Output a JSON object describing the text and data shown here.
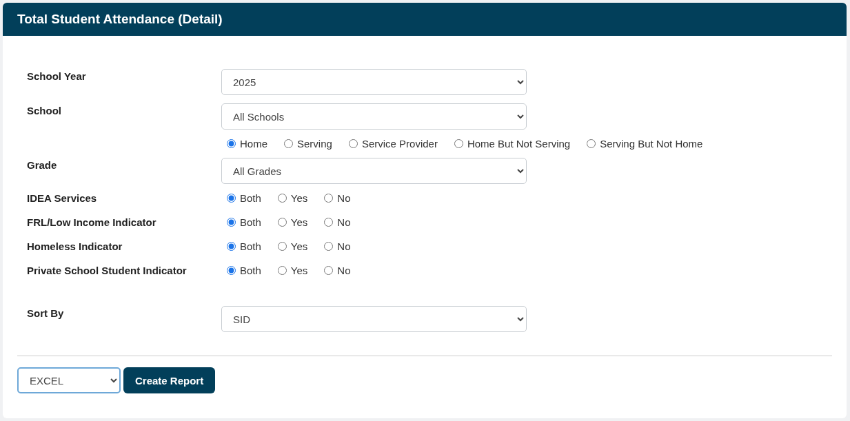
{
  "title": "Total Student Attendance (Detail)",
  "filters": [
    {
      "label": "School Year",
      "kind": "select",
      "value": "2025"
    },
    {
      "label": "School",
      "kind": "select",
      "value": "All Schools",
      "options": [
        {
          "label": "Home",
          "selected": true
        },
        {
          "label": "Serving",
          "selected": false
        },
        {
          "label": "Service Provider",
          "selected": false
        },
        {
          "label": "Home But Not Serving",
          "selected": false
        },
        {
          "label": "Serving But Not Home",
          "selected": false
        }
      ]
    },
    {
      "label": "Grade",
      "kind": "select",
      "value": "All Grades"
    },
    {
      "label": "IDEA Services",
      "kind": "radio",
      "options": [
        {
          "label": "Both",
          "selected": true
        },
        {
          "label": "Yes",
          "selected": false
        },
        {
          "label": "No",
          "selected": false
        }
      ]
    },
    {
      "label": "FRL/Low Income Indicator",
      "kind": "radio",
      "options": [
        {
          "label": "Both",
          "selected": true
        },
        {
          "label": "Yes",
          "selected": false
        },
        {
          "label": "No",
          "selected": false
        }
      ]
    },
    {
      "label": "Homeless Indicator",
      "kind": "radio",
      "options": [
        {
          "label": "Both",
          "selected": true
        },
        {
          "label": "Yes",
          "selected": false
        },
        {
          "label": "No",
          "selected": false
        }
      ]
    },
    {
      "label": "Private School Student Indicator",
      "kind": "radio",
      "options": [
        {
          "label": "Both",
          "selected": true
        },
        {
          "label": "Yes",
          "selected": false
        },
        {
          "label": "No",
          "selected": false
        }
      ]
    }
  ],
  "sort_by": {
    "label": "Sort By",
    "value": "SID"
  },
  "footer": {
    "format": "EXCEL",
    "button": "Create Report"
  }
}
